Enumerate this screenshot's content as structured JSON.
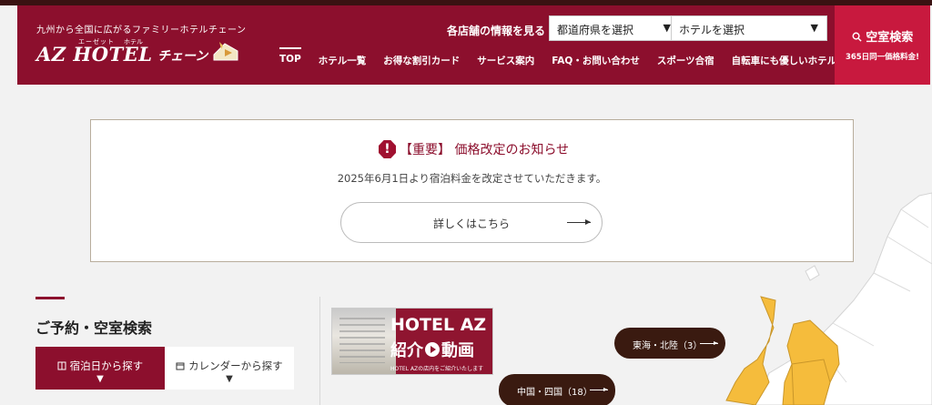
{
  "header": {
    "tagline": "九州から全国に広がるファミリーホテルチェーン",
    "logo": {
      "ruby_left": "エーゼット",
      "ruby_right": "ホテル",
      "main": "AZ HOTEL",
      "chain": "チェーン"
    },
    "store_info_label": "各店舗の情報を見る",
    "pref_select": "都道府県を選択",
    "hotel_select": "ホテルを選択",
    "vacancy_title": "空室検索",
    "vacancy_sub": "365日同一価格料金!"
  },
  "nav": [
    {
      "label": "TOP"
    },
    {
      "label": "ホテル一覧"
    },
    {
      "label": "お得な割引カード"
    },
    {
      "label": "サービス案内"
    },
    {
      "label": "FAQ・お問い合わせ"
    },
    {
      "label": "スポーツ合宿"
    },
    {
      "label": "自転車にも優しいホテル"
    }
  ],
  "notice": {
    "icon": "!",
    "title": "【重要】 価格改定のお知らせ",
    "body": "2025年6月1日より宿泊料金を改定させていただきます。",
    "button": "詳しくはこちら"
  },
  "reservation": {
    "title": "ご予約・空室検索",
    "tab_date": "宿泊日から探す",
    "tab_calendar": "カレンダーから探す"
  },
  "video": {
    "line1": "HOTEL AZ",
    "line2_a": "紹介",
    "line2_b": "動画",
    "line3": "HOTEL AZの店内をご紹介いたします"
  },
  "regions": {
    "tokai": "東海・北陸（3）",
    "chugoku": "中国・四国（18）"
  },
  "colors": {
    "brand": "#8c0f2d",
    "accent": "#c8193e",
    "map_highlight": "#f5bc3c",
    "region_pill": "#3a1a10"
  }
}
